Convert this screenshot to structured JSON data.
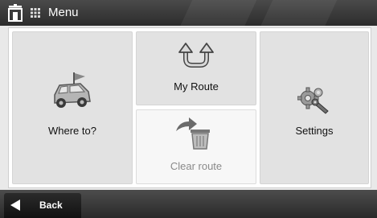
{
  "header": {
    "title": "Menu",
    "icons": [
      "home-icon",
      "grid-icon"
    ]
  },
  "menu": {
    "where_to": {
      "label": "Where to?",
      "icon": "car-destination-icon"
    },
    "my_route": {
      "label": "My Route",
      "icon": "u-turn-arrows-icon"
    },
    "clear_route": {
      "label": "Clear route",
      "icon": "trash-arrow-icon",
      "enabled": false
    },
    "settings": {
      "label": "Settings",
      "icon": "gears-wrench-icon"
    }
  },
  "footer": {
    "back_label": "Back",
    "back_icon": "left-triangle-icon"
  },
  "colors": {
    "titlebar": "#3a3a3a",
    "tile": "#e2e2e2",
    "tile_disabled": "#f7f7f7",
    "disabled_text": "#8a8a8a"
  }
}
